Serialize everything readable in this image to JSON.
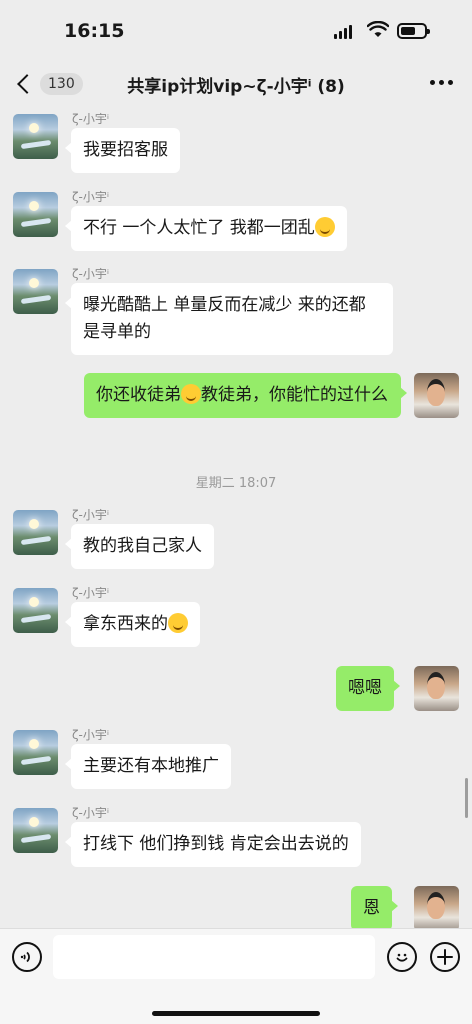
{
  "status_bar": {
    "time": "16:15"
  },
  "nav": {
    "back_count": "130",
    "title": "共享ip计划vip~ζ-小宇ⁱ  (8)"
  },
  "chat": {
    "timestamp": "星期二 18:07",
    "messages": [
      {
        "sender": "ζ-小宇ⁱ",
        "text": "我要招客服"
      },
      {
        "sender": "ζ-小宇ⁱ",
        "text": "不行 一个人太忙了 我都一团乱"
      },
      {
        "sender": "ζ-小宇ⁱ",
        "text": "曝光酷酷上 单量反而在减少 来的还都是寻单的"
      },
      {
        "sender": "me",
        "text_a": "你还收徒弟",
        "text_b": "教徒弟，你能忙的过什么"
      },
      {
        "sender": "ζ-小宇ⁱ",
        "text": "教的我自己家人"
      },
      {
        "sender": "ζ-小宇ⁱ",
        "text": "拿东西来的"
      },
      {
        "sender": "me",
        "text": "嗯嗯"
      },
      {
        "sender": "ζ-小宇ⁱ",
        "text": "主要还有本地推广"
      },
      {
        "sender": "ζ-小宇ⁱ",
        "text": "打线下 他们挣到钱 肯定会出去说的"
      },
      {
        "sender": "me",
        "text": "恩"
      }
    ]
  },
  "input_bar": {
    "voice_icon": "voice-icon",
    "emoji_icon": "emoji-icon",
    "plus_icon": "plus-icon",
    "input_value": ""
  },
  "colors": {
    "me_bubble": "#95ec69",
    "other_bubble": "#ffffff",
    "background": "#ededed"
  }
}
